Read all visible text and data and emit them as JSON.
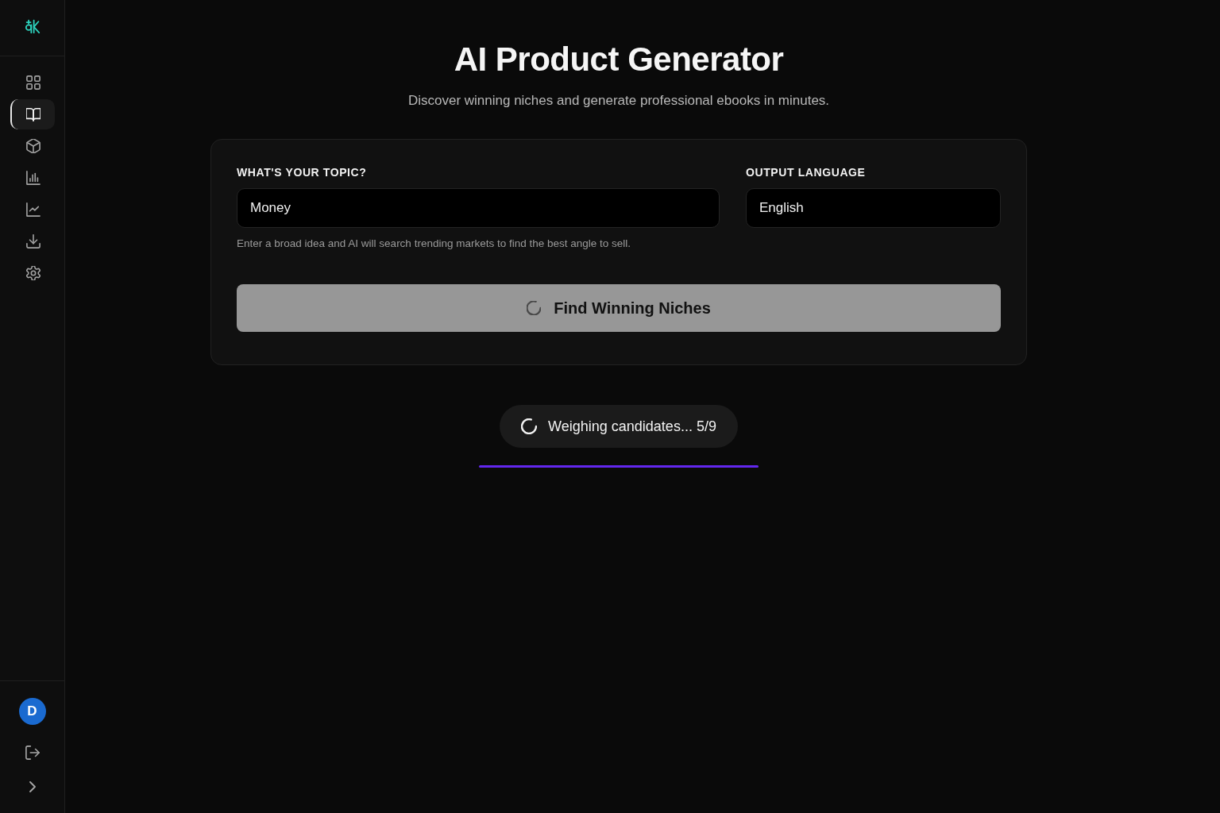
{
  "sidebar": {
    "nav": [
      {
        "kind": "grid",
        "selected": false
      },
      {
        "kind": "book",
        "selected": true
      },
      {
        "kind": "cube",
        "selected": false
      },
      {
        "kind": "bars",
        "selected": false
      },
      {
        "kind": "trend",
        "selected": false
      },
      {
        "kind": "download",
        "selected": false
      },
      {
        "kind": "gear",
        "selected": false
      }
    ],
    "avatar": "D"
  },
  "header": {
    "title": "AI Product Generator",
    "subtitle": "Discover winning niches and generate professional ebooks in minutes."
  },
  "form": {
    "topic": {
      "label": "WHAT'S YOUR TOPIC?",
      "value": "Money",
      "hint": "Enter a broad idea and AI will search trending markets to find the best angle to sell."
    },
    "language": {
      "label": "OUTPUT LANGUAGE",
      "value": "English"
    },
    "button": {
      "label": "Find Winning Niches",
      "loading": true
    }
  },
  "status": {
    "text": "Weighing candidates... 5/9"
  }
}
